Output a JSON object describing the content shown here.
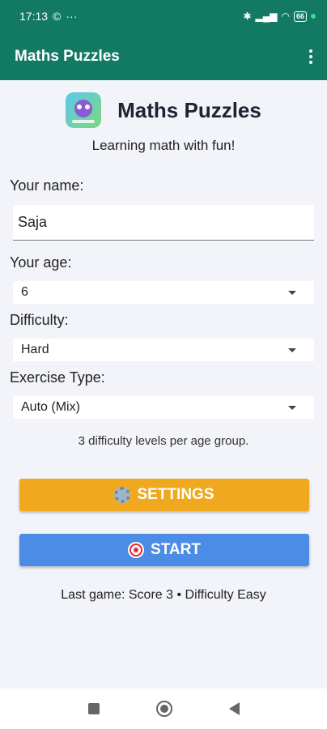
{
  "status": {
    "time": "17:13",
    "notif1": "©",
    "notif2": "···",
    "battery": "66"
  },
  "appbar": {
    "title": "Maths Puzzles"
  },
  "header": {
    "app_name": "Maths Puzzles",
    "subtitle": "Learning math with fun!"
  },
  "form": {
    "name_label": "Your name:",
    "name_value": "Saja",
    "age_label": "Your age:",
    "age_value": "6",
    "difficulty_label": "Difficulty:",
    "difficulty_value": "Hard",
    "exercise_label": "Exercise Type:",
    "exercise_value": "Auto (Mix)"
  },
  "info": "3 difficulty levels per age group.",
  "buttons": {
    "settings": "SETTINGS",
    "start": "START"
  },
  "last_game": "Last game: Score 3 • Difficulty Easy",
  "colors": {
    "primary": "#127a63",
    "settings": "#f0a91f",
    "start": "#4a8ce6"
  },
  "icons": {
    "settings": "gear-icon",
    "start": "target-icon"
  }
}
